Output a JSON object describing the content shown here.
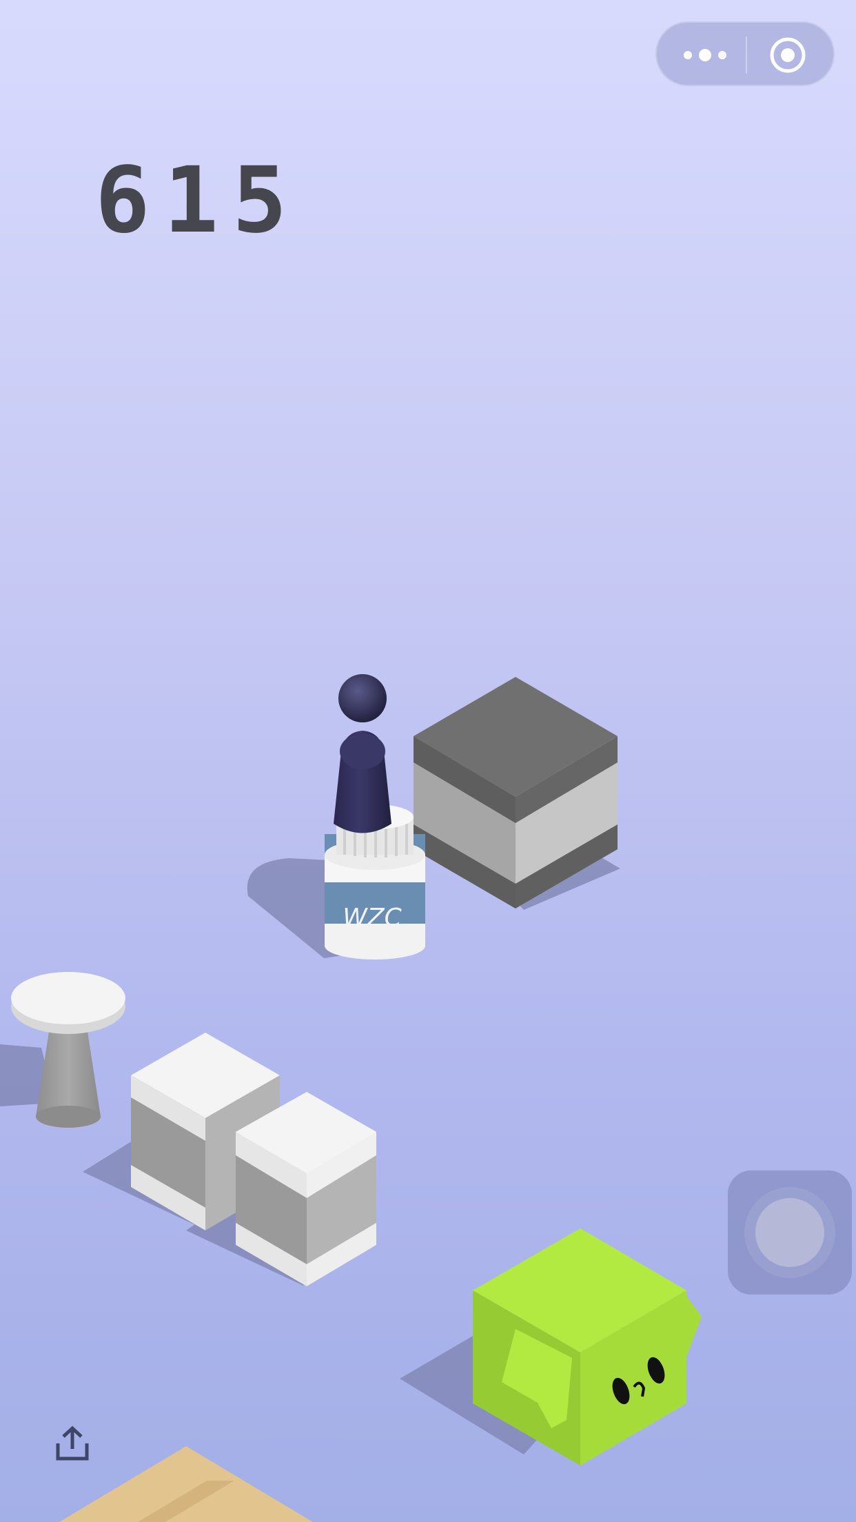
{
  "game": {
    "score": "615",
    "bottle_label": "WZC"
  },
  "top_bar": {
    "more_icon": "more-dots-icon",
    "close_icon": "target-close-icon"
  },
  "controls": {
    "floating_icon": "floating-assistive-icon",
    "share_icon": "share-upload-icon"
  },
  "colors": {
    "background_top": "#d8dafd",
    "background_bottom": "#a3afe7",
    "score": "#46464e",
    "player": "#2f2c52",
    "green_cube": "#b3ea41",
    "dark_box_top": "#707070"
  }
}
